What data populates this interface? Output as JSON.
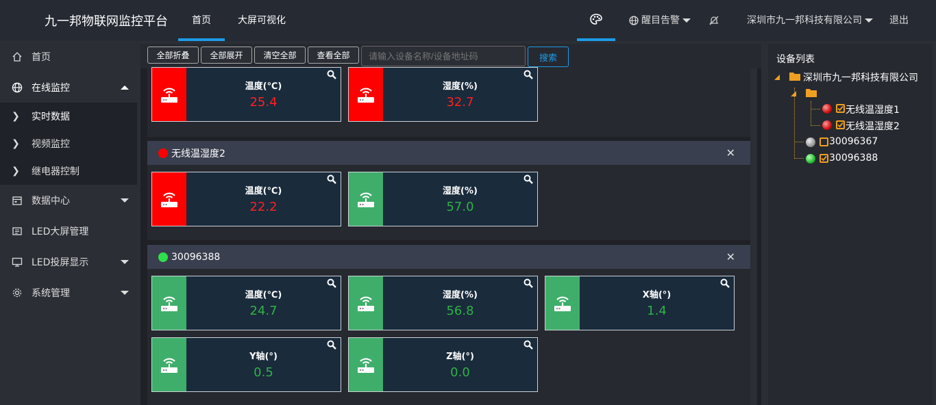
{
  "header": {
    "app_title": "九一邦物联网监控平台",
    "tabs": [
      {
        "label": "首页"
      },
      {
        "label": "大屏可视化"
      }
    ],
    "alarm_label": "醒目告警",
    "company": "深圳市九一邦科技有限公司",
    "logout": "退出"
  },
  "sidebar": {
    "items": [
      {
        "label": "首页",
        "icon": "home-icon"
      },
      {
        "label": "在线监控",
        "icon": "globe-icon"
      },
      {
        "label": "实时数据"
      },
      {
        "label": "视频监控"
      },
      {
        "label": "继电器控制"
      },
      {
        "label": "数据中心",
        "icon": "calendar-icon"
      },
      {
        "label": "LED大屏管理",
        "icon": "led-icon"
      },
      {
        "label": "LED投屏显示",
        "icon": "monitor-icon"
      },
      {
        "label": "系统管理",
        "icon": "gear-icon"
      }
    ]
  },
  "toolbar": {
    "collapse_all": "全部折叠",
    "expand_all": "全部展开",
    "clear_all": "清空全部",
    "view_all": "查看全部",
    "search_placeholder": "请输入设备名称/设备地址码",
    "search": "搜索"
  },
  "colors": {
    "alarm": "#ff0000",
    "normal": "#3fae6a",
    "value_normal": "#2fb344",
    "value_alarm": "#ff2020"
  },
  "groups": [
    {
      "name": "",
      "status": "red",
      "cards": [
        {
          "label": "温度(℃)",
          "value": "25.4",
          "status": "alarm"
        },
        {
          "label": "湿度(%)",
          "value": "32.7",
          "status": "alarm"
        }
      ]
    },
    {
      "name": "无线温湿度2",
      "status": "red",
      "cards": [
        {
          "label": "温度(℃)",
          "value": "22.2",
          "status": "alarm"
        },
        {
          "label": "湿度(%)",
          "value": "57.0",
          "status": "normal"
        }
      ]
    },
    {
      "name": "30096388",
      "status": "green",
      "cards": [
        {
          "label": "温度(℃)",
          "value": "24.7",
          "status": "normal"
        },
        {
          "label": "湿度(%)",
          "value": "56.8",
          "status": "normal"
        },
        {
          "label": "X轴(°)",
          "value": "1.4",
          "status": "normal"
        },
        {
          "label": "Y轴(°)",
          "value": "0.5",
          "status": "normal"
        },
        {
          "label": "Z轴(°)",
          "value": "0.0",
          "status": "normal"
        }
      ]
    }
  ],
  "device_tree": {
    "title": "设备列表",
    "root": "深圳市九一邦科技有限公司",
    "devices": [
      {
        "name": "无线温湿度1",
        "status": "red",
        "checked": true
      },
      {
        "name": "无线温湿度2",
        "status": "red",
        "checked": true
      },
      {
        "name": "30096367",
        "status": "gray",
        "checked": false
      },
      {
        "name": "30096388",
        "status": "green",
        "checked": true
      }
    ]
  }
}
